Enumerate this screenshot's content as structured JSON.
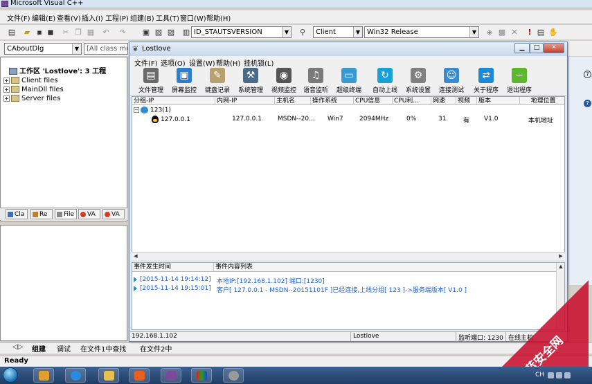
{
  "vc": {
    "title": "Microsoft Visual C++",
    "menu": [
      "文件(F)",
      "编辑(E)",
      "查看(V)",
      "插入(I)",
      "工程(P)",
      "组建(B)",
      "工具(T)",
      "窗口(W)",
      "帮助(H)"
    ],
    "toolbar_combo_id": "ID_STAUTSVERSION",
    "project_combo": "Client",
    "config_combo": "Win32 Release",
    "class_combo": "CAboutDlg",
    "members_combo": "[All class me",
    "workspace": {
      "root": "工作区 'Lostlove': 3 工程",
      "items": [
        "Client files",
        "MainDll files",
        "Server files"
      ]
    },
    "ws_tabs": [
      "Cla",
      "Re",
      "File",
      "VA",
      "VA"
    ],
    "output_tabs": [
      "组建",
      "调试",
      "在文件1中查找",
      "在文件2中"
    ],
    "status": "Ready"
  },
  "lostlove": {
    "title": "Lostlove",
    "menu": [
      "文件(F)",
      "选项(O)",
      "设置(W)",
      "帮助(H)",
      "挂机锁(L)"
    ],
    "toolbar": [
      {
        "label": "文件管理",
        "icon": "file-manager-icon",
        "color": "#6a6a6a",
        "glyph": "▤"
      },
      {
        "label": "屏幕监控",
        "icon": "screen-monitor-icon",
        "color": "#2c7fd0",
        "glyph": "▣"
      },
      {
        "label": "键盘记录",
        "icon": "keyboard-log-icon",
        "color": "#b8a070",
        "glyph": "✎"
      },
      {
        "label": "系统管理",
        "icon": "system-manage-icon",
        "color": "#4a6a8a",
        "glyph": "⚒"
      },
      {
        "label": "视频监控",
        "icon": "video-monitor-icon",
        "color": "#555555",
        "glyph": "◉"
      },
      {
        "label": "语音监听",
        "icon": "audio-listen-icon",
        "color": "#7a7a7a",
        "glyph": "♫"
      },
      {
        "label": "超级终端",
        "icon": "super-terminal-icon",
        "color": "#3a9ad0",
        "glyph": "▭"
      },
      {
        "label": "自动上线",
        "icon": "auto-online-icon",
        "color": "#1aa0d8",
        "glyph": "↻"
      },
      {
        "label": "系统设置",
        "icon": "system-settings-icon",
        "color": "#808080",
        "glyph": "⚙"
      },
      {
        "label": "连接测试",
        "icon": "connect-test-icon",
        "color": "#3a8ad0",
        "glyph": "☺"
      },
      {
        "label": "关于程序",
        "icon": "about-icon",
        "color": "#1a8ad8",
        "glyph": "⇄"
      },
      {
        "label": "退出程序",
        "icon": "exit-icon",
        "color": "#5cb82a",
        "glyph": "−"
      }
    ],
    "columns": [
      "分组-IP",
      "内网-IP",
      "主机名",
      "操作系统",
      "CPU信息",
      "CPU利...",
      "网速",
      "视频",
      "版本",
      "地理位置"
    ],
    "group": "123(1)",
    "host": {
      "ip": "127.0.0.1",
      "lan_ip": "127.0.0.1",
      "hostname": "MSDN--20...",
      "os": "Win7",
      "cpu": "2094MHz",
      "cpu_usage": "0%",
      "speed": "31",
      "video": "有",
      "version": "V1.0",
      "location": "本机地址"
    },
    "log_columns": [
      "事件发生时间",
      "事件内容列表"
    ],
    "logs": [
      {
        "time": "[2015-11-14 19:14:12]",
        "content": "本地IP:[192.168.1.102] 端口:[1230]"
      },
      {
        "time": "[2015-11-14 19:15:01]",
        "content": "客户[ 127.0.0.1 - MSDN--20151101F ]已经连接,上线分组[ 123 ]->服务端版本[ V1.0 ]"
      }
    ],
    "status_ip": "192.168.1.102",
    "status_name": "Lostlove",
    "status_port": "监听端口: 1230",
    "status_online": "在线主机"
  },
  "taskbar": {
    "tray_lang": "CH"
  },
  "watermark": "红蓝安全网"
}
